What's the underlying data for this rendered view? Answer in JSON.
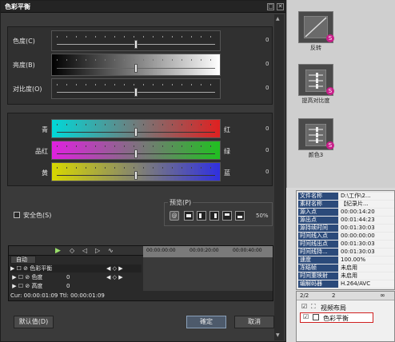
{
  "dialog": {
    "title": "色彩平衡",
    "close_glyph": "✕",
    "minimize_glyph": "–",
    "restore_glyph": "□",
    "sliders_top": [
      {
        "label": "色度(C)",
        "value": "0"
      },
      {
        "label": "亮度(B)",
        "value": "0"
      },
      {
        "label": "对比度(O)",
        "value": "0"
      }
    ],
    "color_sliders": [
      {
        "left": "青",
        "right": "红",
        "value": "0",
        "gradient_from": "#00d8d8",
        "gradient_to": "#e02020"
      },
      {
        "left": "品红",
        "right": "绿",
        "value": "0",
        "gradient_from": "#e020e0",
        "gradient_to": "#20c020"
      },
      {
        "left": "黄",
        "right": "蓝",
        "value": "0",
        "gradient_from": "#d8d800",
        "gradient_to": "#3030e0"
      }
    ],
    "safe_color_label": "安全色(S)",
    "preview_label": "预览(P)",
    "preview_percent": "50%",
    "timeline": {
      "mode_label": "自动",
      "ruler_labels": [
        "00:00:00:00",
        "00:00:20:00",
        "00:00:40:00"
      ],
      "rows": [
        {
          "label": "色彩平衡",
          "value": ""
        },
        {
          "label": "色度",
          "value": "0"
        },
        {
          "label": "高度",
          "value": "0"
        }
      ],
      "status": "Cur: 00:00:01:09  Ttl: 00:00:01:09"
    },
    "buttons": {
      "default": "默认值(D)",
      "ok": "確定",
      "cancel": "取消"
    }
  },
  "right_panel": {
    "effects": [
      {
        "label": "反转",
        "icon": "curve-icon"
      },
      {
        "label": "提高对比度",
        "icon": "sliders-icon"
      },
      {
        "label": "颜色3",
        "icon": "sliders-icon"
      }
    ]
  },
  "info_panel": {
    "rows": [
      {
        "key": "文件名称",
        "value": "D:\\工作\\2..."
      },
      {
        "key": "素材名称",
        "value": "【纪录片..."
      },
      {
        "key": "源入点",
        "value": "00:00:14:20"
      },
      {
        "key": "源出点",
        "value": "00:01:44:23"
      },
      {
        "key": "源持续时间",
        "value": "00:01:30:03"
      },
      {
        "key": "时间线入点",
        "value": "00:00:00:00"
      },
      {
        "key": "时间线出点",
        "value": "00:01:30:03"
      },
      {
        "key": "时间线持...",
        "value": "00:01:30:03"
      },
      {
        "key": "速度",
        "value": "100.00%"
      },
      {
        "key": "冻结帧",
        "value": "未启用"
      },
      {
        "key": "时间重映射",
        "value": "未启用"
      },
      {
        "key": "编解码器",
        "value": "H.264/AVC"
      }
    ]
  },
  "layer_panel": {
    "page": "2/2",
    "count": "2",
    "items": [
      {
        "label": "视频布局",
        "checked": true
      },
      {
        "label": "色彩平衡",
        "checked": true
      }
    ]
  }
}
